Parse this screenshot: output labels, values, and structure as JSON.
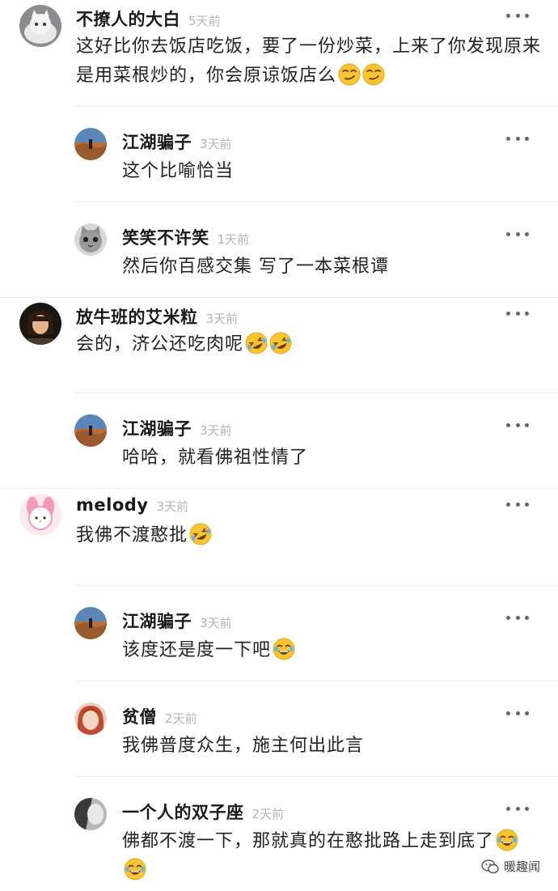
{
  "comments": [
    {
      "level": "top",
      "user": "不撩人的大白",
      "time": "5天前",
      "text": "这好比你去饭店吃饭，要了一份炒菜，上来了你发现原来是用菜根炒的，你会原谅饭店么",
      "emojis": [
        "smirk",
        "smirk"
      ],
      "avatar": "cat-white"
    },
    {
      "level": "reply",
      "user": "江湖骗子",
      "time": "3天前",
      "text": "这个比喻恰当",
      "emojis": [],
      "avatar": "desert"
    },
    {
      "level": "reply",
      "user": "笑笑不许笑",
      "time": "1天前",
      "text": "然后你百感交集 写了一本菜根谭",
      "emojis": [],
      "avatar": "kitten"
    },
    {
      "level": "top",
      "user": "放牛班的艾米粒",
      "time": "3天前",
      "text": "会的，济公还吃肉呢",
      "emojis": [
        "rofl",
        "rofl"
      ],
      "avatar": "girl-bob"
    },
    {
      "level": "reply",
      "user": "江湖骗子",
      "time": "3天前",
      "text": "哈哈，就看佛祖性情了",
      "emojis": [],
      "avatar": "desert"
    },
    {
      "level": "top",
      "user": "melody",
      "time": "3天前",
      "text": "我佛不渡憨批",
      "emojis": [
        "rofl"
      ],
      "avatar": "melody"
    },
    {
      "level": "reply",
      "user": "江湖骗子",
      "time": "3天前",
      "text": "该度还是度一下吧",
      "emojis": [
        "joy"
      ],
      "avatar": "desert"
    },
    {
      "level": "reply",
      "user": "贫僧",
      "time": "2天前",
      "text": "我佛普度众生，施主何出此言",
      "emojis": [],
      "avatar": "redhead"
    },
    {
      "level": "reply",
      "user": "一个人的双子座",
      "time": "2天前",
      "text": "佛都不渡一下，那就真的在憨批路上走到底了",
      "emojis": [
        "joy",
        "joy"
      ],
      "avatar": "bw"
    }
  ],
  "watermark": "暖趣闻"
}
